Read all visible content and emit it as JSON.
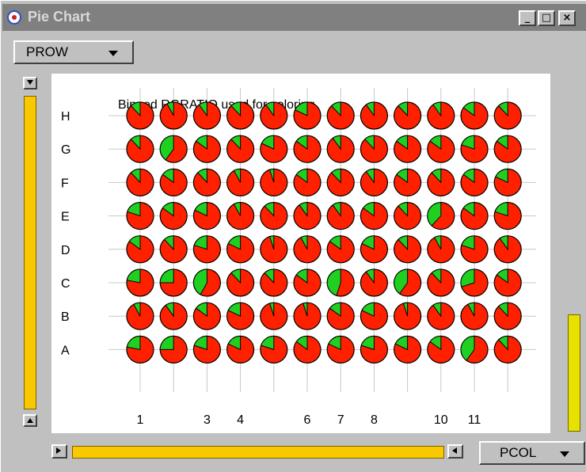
{
  "window": {
    "title": "Pie Chart",
    "minimize_label": "_",
    "maximize_label": "□",
    "close_label": "×"
  },
  "controls": {
    "row_selector": "PROW",
    "col_selector": "PCOL"
  },
  "colors": {
    "slice_major": "#ff2000",
    "slice_minor": "#20d020",
    "scroll_track": "#f8c800",
    "right_slider": "#e8e000"
  },
  "chart_data": {
    "type": "pie",
    "title": "Binned RGRATIO used for coloring",
    "row_labels": [
      "A",
      "B",
      "C",
      "D",
      "E",
      "F",
      "G",
      "H"
    ],
    "column_tick_labels": [
      "1",
      "",
      "3",
      "4",
      "",
      "6",
      "7",
      "8",
      "",
      "10",
      "11",
      ""
    ],
    "green_fraction": [
      [
        0.22,
        0.25,
        0.2,
        0.18,
        0.2,
        0.15,
        0.18,
        0.2,
        0.18,
        0.15,
        0.4,
        0.12
      ],
      [
        0.08,
        0.1,
        0.15,
        0.18,
        0.05,
        0.05,
        0.15,
        0.18,
        0.05,
        0.1,
        0.08,
        0.12
      ],
      [
        0.22,
        0.25,
        0.42,
        0.12,
        0.12,
        0.15,
        0.45,
        0.1,
        0.4,
        0.12,
        0.3,
        0.15
      ],
      [
        0.15,
        0.12,
        0.2,
        0.18,
        0.05,
        0.08,
        0.15,
        0.18,
        0.12,
        0.08,
        0.2,
        0.1
      ],
      [
        0.2,
        0.15,
        0.18,
        0.08,
        0.12,
        0.1,
        0.1,
        0.15,
        0.12,
        0.38,
        0.15,
        0.2
      ],
      [
        0.12,
        0.15,
        0.12,
        0.08,
        0.05,
        0.15,
        0.12,
        0.1,
        0.15,
        0.12,
        0.15,
        0.18
      ],
      [
        0.12,
        0.4,
        0.15,
        0.12,
        0.18,
        0.15,
        0.1,
        0.12,
        0.15,
        0.15,
        0.2,
        0.15
      ],
      [
        0.12,
        0.08,
        0.1,
        0.12,
        0.1,
        0.18,
        0.12,
        0.1,
        0.12,
        0.1,
        0.15,
        0.12
      ]
    ]
  }
}
